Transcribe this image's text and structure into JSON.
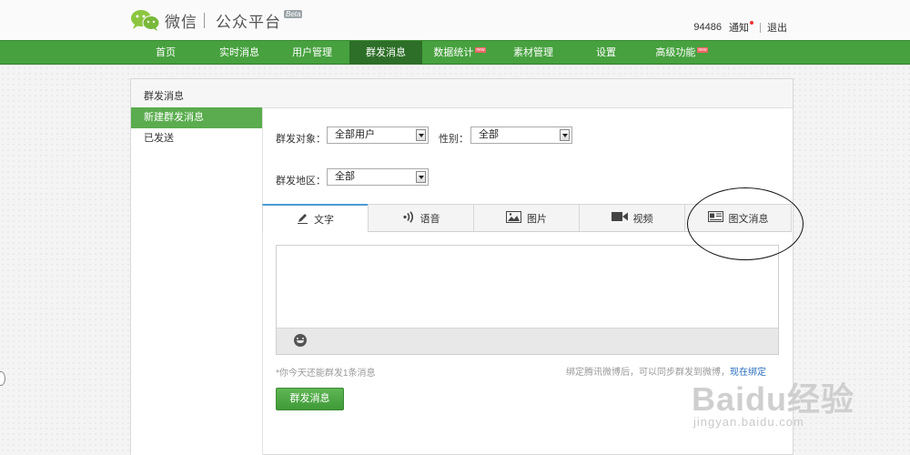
{
  "header": {
    "brand_name": "微信",
    "brand_sub": "公众平台",
    "beta_label": "Beta",
    "user_id": "94486",
    "notify_label": "通知",
    "logout_label": "退出"
  },
  "nav": {
    "items": [
      {
        "label": "首页"
      },
      {
        "label": "实时消息"
      },
      {
        "label": "用户管理"
      },
      {
        "label": "群发消息"
      },
      {
        "label": "数据统计"
      },
      {
        "label": "素材管理"
      },
      {
        "label": "设置"
      },
      {
        "label": "高级功能"
      }
    ],
    "active": "群发消息",
    "new_badge": "new"
  },
  "panel": {
    "title": "群发消息"
  },
  "sidebar": {
    "items": [
      {
        "label": "新建群发消息"
      },
      {
        "label": "已发送"
      }
    ]
  },
  "form": {
    "target_label": "群发对象：",
    "target_value": "全部用户",
    "gender_label": "性别：",
    "gender_value": "全部",
    "region_label": "群发地区：",
    "region_value": "全部"
  },
  "tabs": [
    {
      "label": "文字",
      "icon": "pencil-icon"
    },
    {
      "label": "语音",
      "icon": "sound-icon"
    },
    {
      "label": "图片",
      "icon": "image-icon"
    },
    {
      "label": "视频",
      "icon": "video-icon"
    },
    {
      "label": "图文消息",
      "icon": "news-icon"
    }
  ],
  "footer": {
    "quota_hint": "*你今天还能群发1条消息",
    "weibo_hint": "绑定腾讯微博后，可以同步群发到微博，",
    "weibo_link": "现在绑定",
    "send_label": "群发消息"
  },
  "watermark": {
    "logo": "Baidu经验",
    "url": "jingyan.baidu.com"
  },
  "colors": {
    "nav_green": "#46a13e",
    "nav_active": "#2d6f28",
    "sidebar_active": "#5aac4e",
    "tab_active_border": "#4a9bd4",
    "link_blue": "#2a6ebb"
  }
}
